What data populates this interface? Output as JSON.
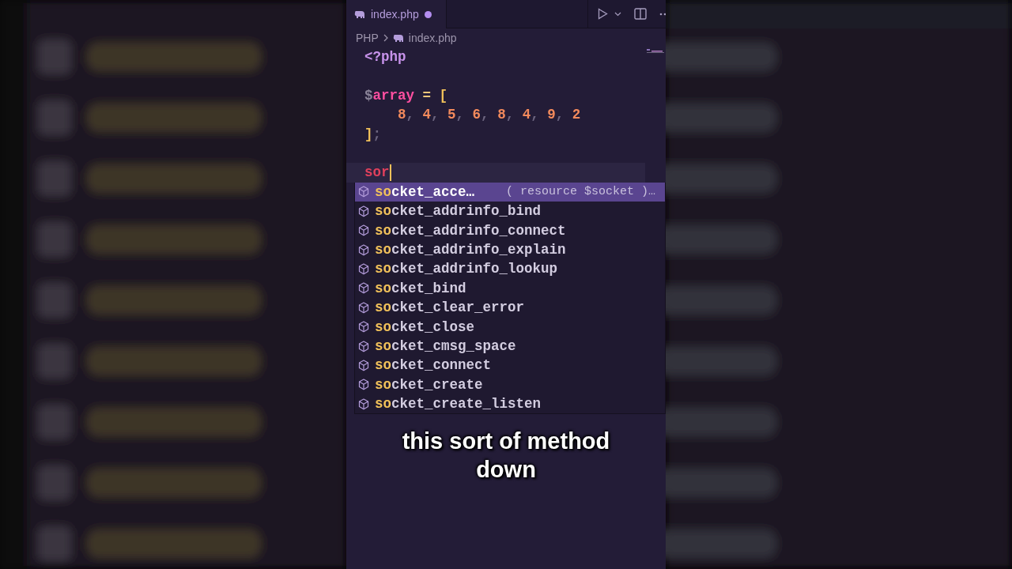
{
  "tab": {
    "label": "index.php",
    "modified": true
  },
  "breadcrumb": [
    {
      "label": "PHP"
    },
    {
      "label": "index.php"
    }
  ],
  "code_lines": [
    {
      "kind": "code",
      "tokens": [
        {
          "text": "<?php",
          "kind": "keyword"
        }
      ]
    },
    {
      "kind": "blank"
    },
    {
      "kind": "code",
      "tokens": [
        {
          "text": "$",
          "kind": "sigil"
        },
        {
          "text": "array",
          "kind": "variable"
        },
        {
          "text": " = ",
          "kind": "operator"
        },
        {
          "text": "[",
          "kind": "bracket"
        }
      ]
    },
    {
      "kind": "code",
      "tokens": [
        {
          "text": "    8",
          "kind": "number"
        },
        {
          "text": ", ",
          "kind": "punct"
        },
        {
          "text": "4",
          "kind": "number"
        },
        {
          "text": ", ",
          "kind": "punct"
        },
        {
          "text": "5",
          "kind": "number"
        },
        {
          "text": ", ",
          "kind": "punct"
        },
        {
          "text": "6",
          "kind": "number"
        },
        {
          "text": ", ",
          "kind": "punct"
        },
        {
          "text": "8",
          "kind": "number"
        },
        {
          "text": ", ",
          "kind": "punct"
        },
        {
          "text": "4",
          "kind": "number"
        },
        {
          "text": ", ",
          "kind": "punct"
        },
        {
          "text": "9",
          "kind": "number"
        },
        {
          "text": ", ",
          "kind": "punct"
        },
        {
          "text": "2",
          "kind": "number"
        }
      ]
    },
    {
      "kind": "code",
      "tokens": [
        {
          "text": "]",
          "kind": "bracket"
        },
        {
          "text": ";",
          "kind": "punct"
        }
      ]
    },
    {
      "kind": "blank"
    },
    {
      "kind": "current",
      "tokens": [
        {
          "text": "sor",
          "kind": "typed"
        }
      ]
    }
  ],
  "suggestions": [
    {
      "match": "so",
      "rest": "cket_acce…",
      "detail": "( resource $socket )…",
      "selected": true
    },
    {
      "match": "so",
      "rest": "cket_addrinfo_bind",
      "selected": false
    },
    {
      "match": "so",
      "rest": "cket_addrinfo_connect",
      "selected": false
    },
    {
      "match": "so",
      "rest": "cket_addrinfo_explain",
      "selected": false
    },
    {
      "match": "so",
      "rest": "cket_addrinfo_lookup",
      "selected": false
    },
    {
      "match": "so",
      "rest": "cket_bind",
      "selected": false
    },
    {
      "match": "so",
      "rest": "cket_clear_error",
      "selected": false
    },
    {
      "match": "so",
      "rest": "cket_close",
      "selected": false
    },
    {
      "match": "so",
      "rest": "cket_cmsg_space",
      "selected": false
    },
    {
      "match": "so",
      "rest": "cket_connect",
      "selected": false
    },
    {
      "match": "so",
      "rest": "cket_create",
      "selected": false
    },
    {
      "match": "so",
      "rest": "cket_create_listen",
      "selected": false
    }
  ],
  "caption": "this sort of method down"
}
